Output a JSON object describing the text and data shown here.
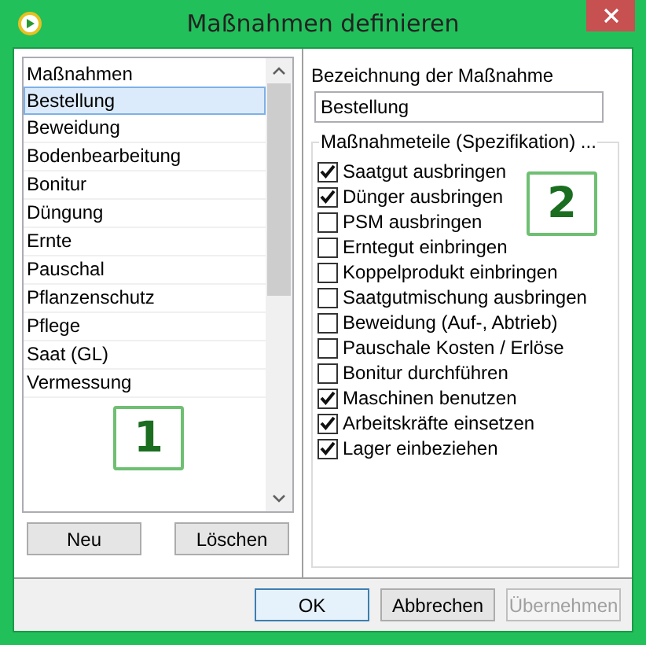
{
  "window": {
    "title": "Maßnahmen definieren"
  },
  "measures_list": {
    "header": "Maßnahmen",
    "items": [
      {
        "label": "Bestellung",
        "selected": true
      },
      {
        "label": "Beweidung",
        "selected": false
      },
      {
        "label": "Bodenbearbeitung",
        "selected": false
      },
      {
        "label": "Bonitur",
        "selected": false
      },
      {
        "label": "Düngung",
        "selected": false
      },
      {
        "label": "Ernte",
        "selected": false
      },
      {
        "label": "Pauschal",
        "selected": false
      },
      {
        "label": "Pflanzenschutz",
        "selected": false
      },
      {
        "label": "Pflege",
        "selected": false
      },
      {
        "label": "Saat (GL)",
        "selected": false
      },
      {
        "label": "Vermessung",
        "selected": false
      }
    ]
  },
  "list_buttons": [
    "Neu",
    "Löschen"
  ],
  "name_field": {
    "label": "Bezeichnung der Maßnahme",
    "value": "Bestellung"
  },
  "components": {
    "title": "Maßnahmeteile (Spezifikation) ...",
    "items": [
      {
        "label": "Saatgut ausbringen",
        "checked": true
      },
      {
        "label": "Dünger ausbringen",
        "checked": true
      },
      {
        "label": "PSM ausbringen",
        "checked": false
      },
      {
        "label": "Erntegut einbringen",
        "checked": false
      },
      {
        "label": "Koppelprodukt einbringen",
        "checked": false
      },
      {
        "label": "Saatgutmischung ausbringen",
        "checked": false
      },
      {
        "label": "Beweidung (Auf-, Abtrieb)",
        "checked": false
      },
      {
        "label": "Pauschale Kosten / Erlöse",
        "checked": false
      },
      {
        "label": "Bonitur durchführen",
        "checked": false
      },
      {
        "label": "Maschinen benutzen",
        "checked": true
      },
      {
        "label": "Arbeitskräfte einsetzen",
        "checked": true
      },
      {
        "label": "Lager einbeziehen",
        "checked": true
      }
    ]
  },
  "annotations": [
    "1",
    "2"
  ],
  "buttons": [
    {
      "label": "OK",
      "default": true,
      "disabled": false
    },
    {
      "label": "Abbrechen",
      "default": false,
      "disabled": false
    },
    {
      "label": "Übernehmen",
      "default": false,
      "disabled": true
    }
  ]
}
